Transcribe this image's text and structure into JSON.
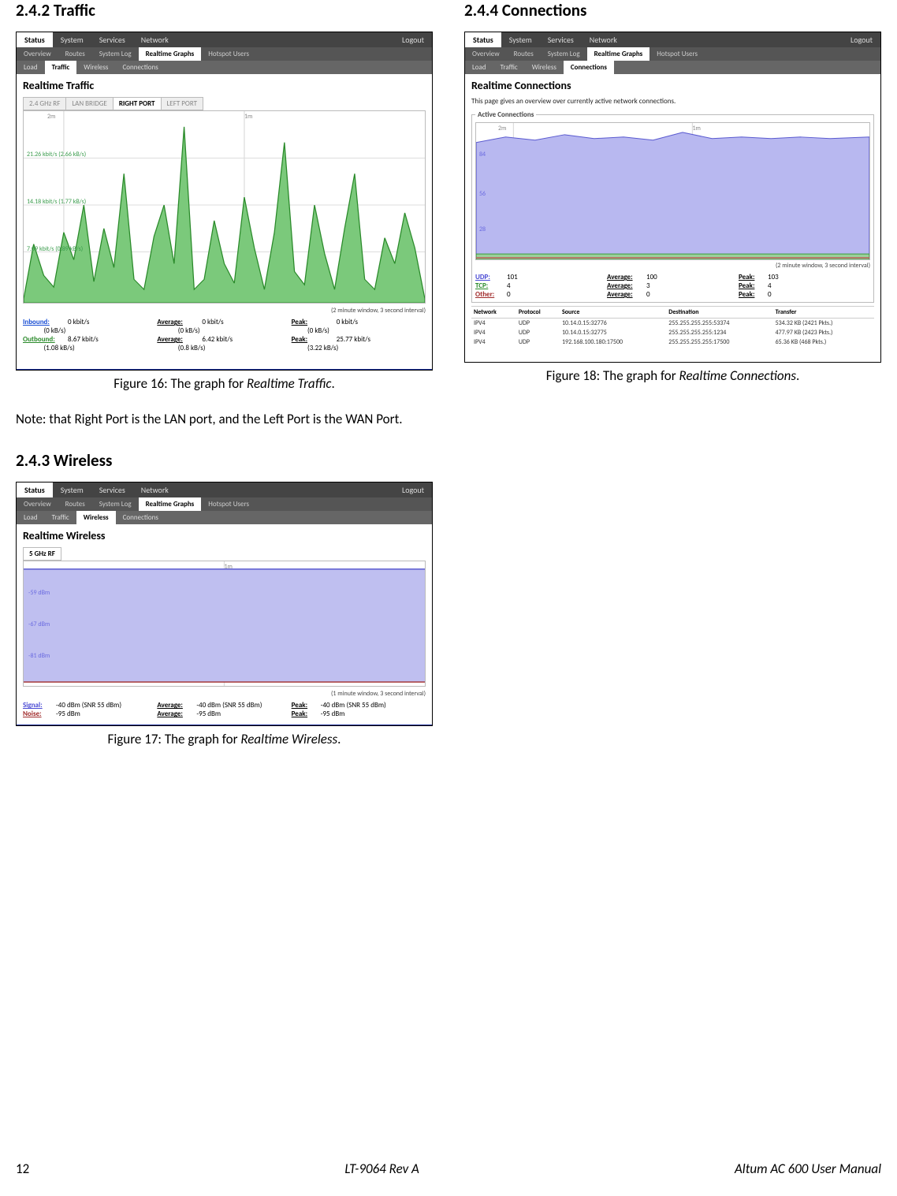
{
  "headings": {
    "s242": "2.4.2 Traffic",
    "s243": "2.4.3 Wireless",
    "s244": "2.4.4 Connections"
  },
  "captions": {
    "f16_pre": "Figure 16: The graph for ",
    "f16_ital": "Realtime Traffic",
    "f16_post": ".",
    "f17_pre": "Figure 17: The graph for ",
    "f17_ital": "Realtime Wireless",
    "f17_post": ".",
    "f18_pre": "Figure 18: The graph for ",
    "f18_ital": "Realtime Connections",
    "f18_post": "."
  },
  "note": "Note: that Right Port is the LAN port, and the Left Port is the WAN Port.",
  "footer": {
    "page": "12",
    "center": "LT-9064 Rev A",
    "right": "Altum AC 600 User Manual"
  },
  "menus": {
    "top": [
      "Status",
      "System",
      "Services",
      "Network",
      "Logout"
    ],
    "sub": [
      "Overview",
      "Routes",
      "System Log",
      "Realtime Graphs",
      "Hotspot Users"
    ],
    "traffic_sub": [
      "Load",
      "Traffic",
      "Wireless",
      "Connections"
    ]
  },
  "fig16": {
    "title": "Realtime Traffic",
    "port_tabs": [
      "2.4 GHz RF",
      "LAN BRIDGE",
      "RIGHT PORT",
      "LEFT PORT"
    ],
    "time_labels": [
      "2m",
      "1m"
    ],
    "y_labels": [
      "21.26 kbit/s (2.66 kB/s)",
      "14.18 kbit/s (1.77 kB/s)",
      "7.09 kbit/s (0.89 kB/s)"
    ],
    "window_note": "(2 minute window, 3 second interval)",
    "stats": {
      "inbound_lab": "Inbound:",
      "inbound": "0 kbit/s",
      "inbound_kb": "(0 kB/s)",
      "outbound_lab": "Outbound:",
      "outbound": "8.67 kbit/s",
      "outbound_kb": "(1.08 kB/s)",
      "avg_lab": "Average:",
      "avg_in": "0 kbit/s",
      "avg_in_kb": "(0 kB/s)",
      "avg_out": "6.42 kbit/s",
      "avg_out_kb": "(0.8 kB/s)",
      "peak_lab": "Peak:",
      "peak_in": "0 kbit/s",
      "peak_in_kb": "(0 kB/s)",
      "peak_out": "25.77 kbit/s",
      "peak_out_kb": "(3.22 kB/s)"
    }
  },
  "fig17": {
    "title": "Realtime Wireless",
    "rf_tab": "5 GHz RF",
    "time_labels": [
      "1m"
    ],
    "y_labels": [
      "-59 dBm",
      "-67 dBm",
      "-81 dBm"
    ],
    "window_note": "(1 minute window, 3 second interval)",
    "stats": {
      "signal_lab": "Signal:",
      "signal": "-40 dBm (SNR 55 dBm)",
      "noise_lab": "Noise:",
      "noise": "-95 dBm",
      "avg_lab": "Average:",
      "avg_sig": "-40 dBm (SNR 55 dBm)",
      "avg_noise": "-95 dBm",
      "peak_lab": "Peak:",
      "peak_sig": "-40 dBm (SNR 55 dBm)",
      "peak_noise": "-95 dBm"
    }
  },
  "fig18": {
    "title": "Realtime Connections",
    "subtitle": "This page gives an overview over currently active network connections.",
    "legend": "Active Connections",
    "time_labels": [
      "2m",
      "1m"
    ],
    "y_labels": [
      "84",
      "56",
      "28"
    ],
    "window_note": "(2 minute window, 3 second interval)",
    "stats": {
      "udp_lab": "UDP:",
      "udp": "101",
      "tcp_lab": "TCP:",
      "tcp": "4",
      "other_lab": "Other:",
      "other": "0",
      "avg_lab": "Average:",
      "avg_udp": "100",
      "avg_tcp": "3",
      "avg_other": "0",
      "peak_lab": "Peak:",
      "peak_udp": "103",
      "peak_tcp": "4",
      "peak_other": "0"
    },
    "table": {
      "headers": [
        "Network",
        "Protocol",
        "Source",
        "Destination",
        "Transfer"
      ],
      "rows": [
        [
          "IPV4",
          "UDP",
          "10.14.0.15:32776",
          "255.255.255.255:53374",
          "534.32 KB (2421 Pkts.)"
        ],
        [
          "IPV4",
          "UDP",
          "10.14.0.15:32775",
          "255.255.255.255:1234",
          "477.97 KB (2423 Pkts.)"
        ],
        [
          "IPV4",
          "UDP",
          "192.168.100.180:17500",
          "255.255.255.255:17500",
          "65.36 KB (468 Pkts.)"
        ]
      ]
    }
  },
  "chart_data": [
    {
      "type": "area",
      "title": "Realtime Traffic — RIGHT PORT (outbound)",
      "xlabel": "time (2-minute window)",
      "ylabel": "kbit/s",
      "ylim": [
        0,
        26
      ],
      "x": [
        0,
        1,
        2,
        3,
        4,
        5,
        6,
        7,
        8,
        9,
        10,
        11,
        12,
        13,
        14,
        15,
        16,
        17,
        18,
        19,
        20,
        21,
        22,
        23,
        24,
        25,
        26,
        27,
        28,
        29,
        30,
        31,
        32,
        33,
        34,
        35,
        36,
        37,
        38,
        39
      ],
      "series": [
        {
          "name": "Outbound",
          "values": [
            1,
            8,
            4,
            2,
            10,
            6,
            14,
            3,
            11,
            5,
            18,
            4,
            2,
            9,
            14,
            6,
            25,
            2,
            4,
            12,
            6,
            3,
            15,
            8,
            2,
            10,
            22,
            5,
            3,
            14,
            7,
            2,
            11,
            18,
            4,
            2,
            9,
            6,
            13,
            8
          ]
        },
        {
          "name": "Inbound",
          "values": [
            0,
            0,
            0,
            0,
            0,
            0,
            0,
            0,
            0,
            0,
            0,
            0,
            0,
            0,
            0,
            0,
            0,
            0,
            0,
            0,
            0,
            0,
            0,
            0,
            0,
            0,
            0,
            0,
            0,
            0,
            0,
            0,
            0,
            0,
            0,
            0,
            0,
            0,
            0,
            0
          ]
        }
      ]
    },
    {
      "type": "line",
      "title": "Realtime Wireless — 5 GHz RF",
      "xlabel": "time (1-minute window)",
      "ylabel": "dBm",
      "ylim": [
        -95,
        -40
      ],
      "x": [
        0,
        1,
        2,
        3,
        4,
        5,
        6,
        7,
        8,
        9,
        10,
        11,
        12,
        13,
        14,
        15,
        16,
        17,
        18,
        19
      ],
      "series": [
        {
          "name": "Signal",
          "values": [
            -40,
            -40,
            -40,
            -40,
            -40,
            -40,
            -40,
            -40,
            -40,
            -40,
            -40,
            -40,
            -40,
            -40,
            -40,
            -40,
            -40,
            -40,
            -40,
            -40
          ]
        },
        {
          "name": "Noise",
          "values": [
            -95,
            -95,
            -95,
            -95,
            -95,
            -95,
            -95,
            -95,
            -95,
            -95,
            -95,
            -95,
            -95,
            -95,
            -95,
            -95,
            -95,
            -95,
            -95,
            -95
          ]
        }
      ]
    },
    {
      "type": "area",
      "title": "Realtime Connections — Active Connections",
      "xlabel": "time (2-minute window)",
      "ylabel": "connections",
      "ylim": [
        0,
        110
      ],
      "x": [
        0,
        1,
        2,
        3,
        4,
        5,
        6,
        7,
        8,
        9,
        10,
        11,
        12,
        13,
        14,
        15,
        16,
        17,
        18,
        19,
        20,
        21,
        22,
        23,
        24,
        25,
        26,
        27,
        28,
        29,
        30,
        31,
        32,
        33,
        34,
        35,
        36,
        37,
        38,
        39
      ],
      "series": [
        {
          "name": "UDP",
          "values": [
            95,
            97,
            99,
            100,
            98,
            100,
            101,
            100,
            99,
            100,
            101,
            102,
            100,
            99,
            100,
            101,
            100,
            99,
            100,
            101,
            103,
            100,
            99,
            100,
            101,
            100,
            99,
            100,
            101,
            100,
            99,
            100,
            101,
            100,
            99,
            100,
            101,
            100,
            99,
            100
          ]
        },
        {
          "name": "TCP",
          "values": [
            3,
            3,
            4,
            3,
            3,
            4,
            3,
            3,
            4,
            3,
            3,
            4,
            3,
            3,
            4,
            3,
            3,
            4,
            3,
            3,
            4,
            3,
            3,
            4,
            3,
            3,
            4,
            3,
            3,
            4,
            3,
            3,
            4,
            3,
            3,
            4,
            3,
            3,
            4,
            3
          ]
        },
        {
          "name": "Other",
          "values": [
            0,
            0,
            0,
            0,
            0,
            0,
            0,
            0,
            0,
            0,
            0,
            0,
            0,
            0,
            0,
            0,
            0,
            0,
            0,
            0,
            0,
            0,
            0,
            0,
            0,
            0,
            0,
            0,
            0,
            0,
            0,
            0,
            0,
            0,
            0,
            0,
            0,
            0,
            0,
            0
          ]
        }
      ]
    }
  ]
}
